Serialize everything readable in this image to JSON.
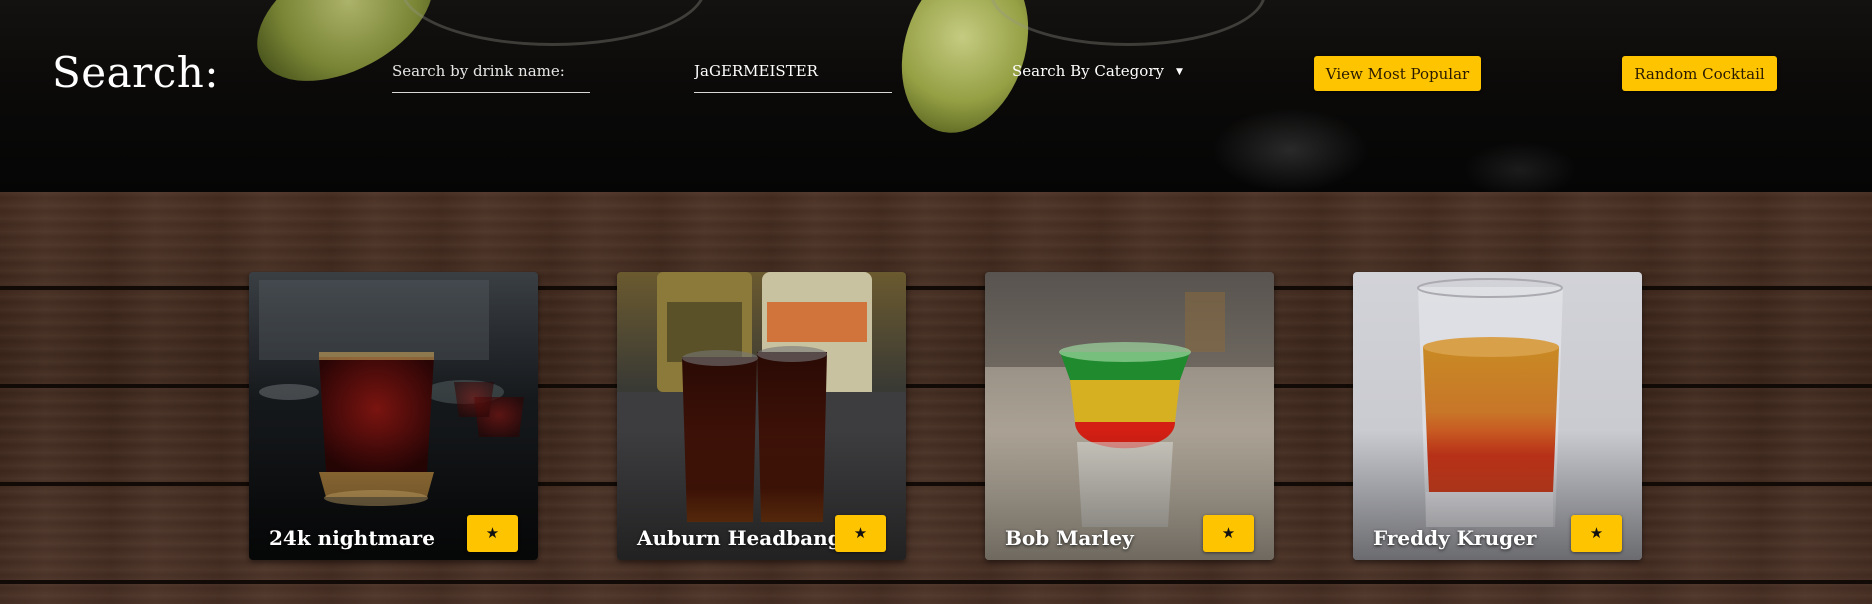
{
  "search": {
    "title": "Search:",
    "name_placeholder": "Search by drink name:",
    "ingredient_value": "JaGERMEISTER",
    "category_label": "Search By Category",
    "caret_glyph": "▼",
    "popular_button": "View Most Popular",
    "random_button": "Random Cocktail"
  },
  "accent_color": "#ffc400",
  "cards": [
    {
      "name": "24k nightmare",
      "favorite_icon": "star-icon",
      "favorite_glyph": "★"
    },
    {
      "name": "Auburn Headbanger",
      "favorite_icon": "star-icon",
      "favorite_glyph": "★"
    },
    {
      "name": "Bob Marley",
      "favorite_icon": "star-icon",
      "favorite_glyph": "★"
    },
    {
      "name": "Freddy Kruger",
      "favorite_icon": "star-icon",
      "favorite_glyph": "★"
    }
  ]
}
